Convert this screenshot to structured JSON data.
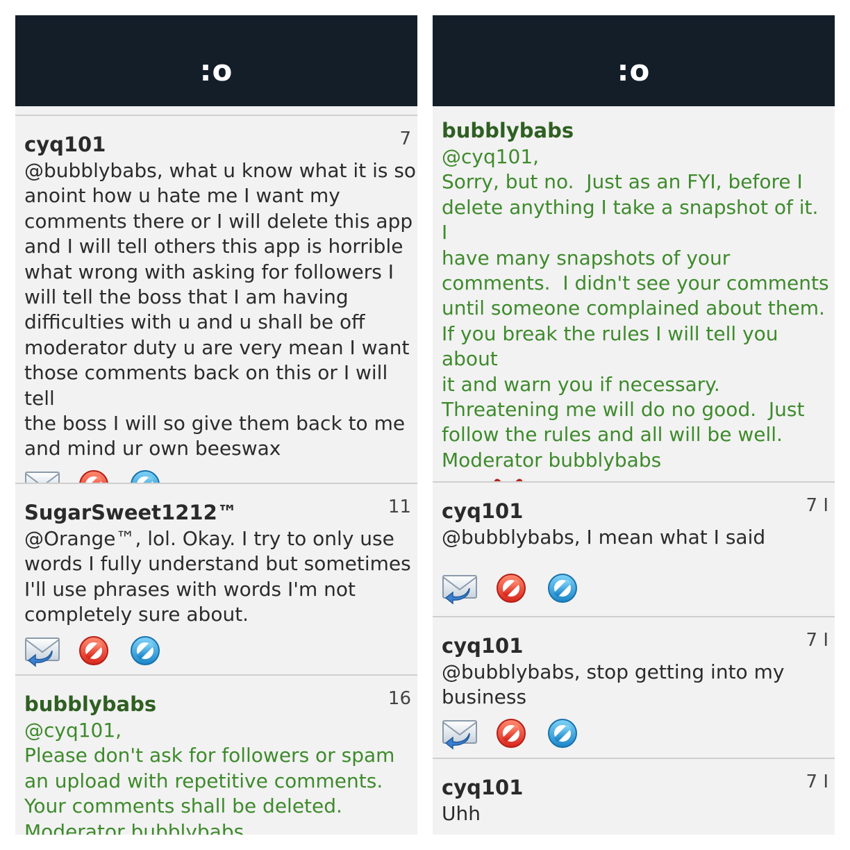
{
  "app": {
    "title": ":o"
  },
  "left_panel": {
    "comments": [
      {
        "username": "cyq101",
        "count": "7",
        "text": "@bubblybabs, what u know what it is so\nanoint how u hate me I want my\ncomments there or I will delete this app\nand I will tell others this app is horrible\nwhat wrong with asking for followers I\nwill tell the boss that I am having\ndifficulties with u and u shall be off\nmoderator duty u are very mean I want\nthose comments back on this or I will tell\nthe boss I will so give them back to me\nand mind ur own beeswax"
      },
      {
        "username": "SugarSweet1212™",
        "count": "11",
        "text": "@Orange™, lol. Okay. I try to only use\nwords I fully understand but sometimes\nI'll use phrases with words I'm not\ncompletely sure about."
      },
      {
        "username": "bubblybabs",
        "count": "16",
        "text": "@cyq101,\nPlease don't ask for followers or spam\nan upload with repetitive comments.\nYour comments shall be deleted.\nModerator bubblybabs"
      }
    ]
  },
  "right_panel": {
    "comments": [
      {
        "username": "bubblybabs",
        "text": "@cyq101,\nSorry, but no.  Just as an FYI, before I\ndelete anything I take a snapshot of it.  I\nhave many snapshots of your\ncomments.  I didn't see your comments\nuntil someone complained about them.\nIf you break the rules I will tell you about\nit and warn you if necessary.\nThreatening me will do no good.  Just\nfollow the rules and all will be well.\nModerator bubblybabs"
      },
      {
        "username": "cyq101",
        "count": "7 I",
        "text": "@bubblybabs, I mean what I said"
      },
      {
        "username": "cyq101",
        "count": "7 I",
        "text": "@bubblybabs, stop getting into my\nbusiness"
      },
      {
        "username": "cyq101",
        "count": "7 I",
        "text": "Uhh"
      }
    ]
  },
  "icons": {
    "reply": "reply-mail-icon",
    "block": "block-icon",
    "report": "report-icon",
    "edit": "pencil-icon",
    "delete": "red-x-icon"
  },
  "colors": {
    "header_bg": "#131e29",
    "panel_bg": "#f2f2f2",
    "moderator_text": "#3e8a2c",
    "moderator_name": "#2f5f22",
    "block_red": "#e8322a",
    "report_blue": "#2a9ad6"
  }
}
